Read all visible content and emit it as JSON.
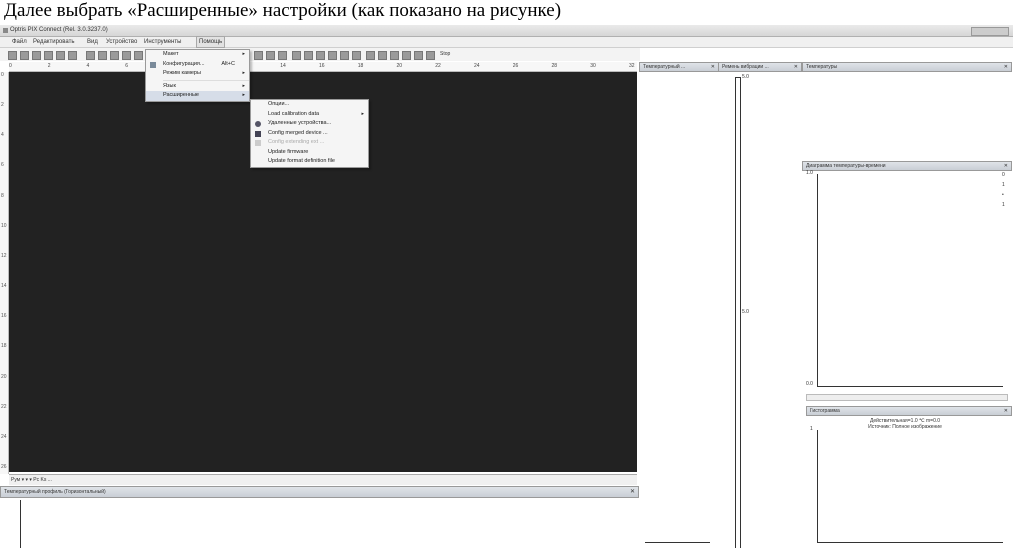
{
  "caption": "Далее выбрать «Расширенные» настройки (как показано на рисунке)",
  "window": {
    "title": "Optris PIX Connect (Rel. 3.0.3237.0)",
    "minmax_label": "_ ▢ ✕"
  },
  "menubar": {
    "items": [
      "Файл",
      "Редактировать",
      "Вид",
      "Устройство",
      "Инструменты",
      "Помощь"
    ]
  },
  "tools_menu": {
    "items": [
      {
        "label": "Макет",
        "shortcut": "",
        "has_arrow": true
      },
      {
        "label": "Конфигурация...",
        "shortcut": "Alt+C",
        "has_arrow": false
      },
      {
        "label": "Режим камеры",
        "shortcut": "",
        "has_arrow": true
      },
      {
        "label": "Язык",
        "shortcut": "",
        "has_arrow": true
      },
      {
        "label": "Расширенные",
        "shortcut": "",
        "has_arrow": true
      }
    ]
  },
  "advanced_submenu": {
    "items": [
      {
        "label": "Опции...",
        "enabled": true,
        "has_arrow": false
      },
      {
        "label": "Load calibration data",
        "enabled": true,
        "has_arrow": true
      },
      {
        "label": "Удаленные устройства...",
        "enabled": true,
        "has_arrow": false
      },
      {
        "label": "Config merged device ...",
        "enabled": true,
        "has_arrow": false
      },
      {
        "label": "Config extending ext ...",
        "enabled": false,
        "has_arrow": false
      },
      {
        "label": "Update firmware",
        "enabled": true,
        "has_arrow": false
      },
      {
        "label": "Update format definition file",
        "enabled": true,
        "has_arrow": false
      }
    ]
  },
  "toolbar": {
    "right_label": "Stop"
  },
  "ruler": {
    "ticks": [
      "0",
      "2",
      "4",
      "6",
      "8",
      "10",
      "12",
      "14",
      "16",
      "18",
      "20",
      "22",
      "24",
      "26",
      "28",
      "30",
      "32"
    ]
  },
  "vruler": {
    "ticks": [
      "0",
      "2",
      "4",
      "6",
      "8",
      "10",
      "12",
      "14",
      "16",
      "18",
      "20",
      "22",
      "24",
      "26"
    ]
  },
  "statusbar": {
    "text": "Рум ▾  ▾  ▾ Рс  Ks  ..."
  },
  "profile_panel": {
    "title": "Температурный профиль (Горизонтальный)",
    "close": "✕"
  },
  "temp_scale_panel": {
    "title": "Температурный ...",
    "close": "✕",
    "top_value": "5.0",
    "mid_value": "5.0"
  },
  "palette_panel": {
    "title": "Ремень вибрации ...",
    "close": "✕"
  },
  "temperatures_panel": {
    "title": "Температуры",
    "close": "✕"
  },
  "temp_time_panel": {
    "title": "Диаграмма температуры-времени",
    "close": "✕",
    "y_top": "1.0",
    "y_bottom": "0.0",
    "side_labels": [
      "0",
      "1",
      "•",
      "1"
    ]
  },
  "histogram_panel": {
    "title": "Гистограмма",
    "close": "✕",
    "line1": "Действительная=1.0 ℃ m=0.0",
    "line2": "Источник: Полное изображение",
    "y_label": "1"
  }
}
